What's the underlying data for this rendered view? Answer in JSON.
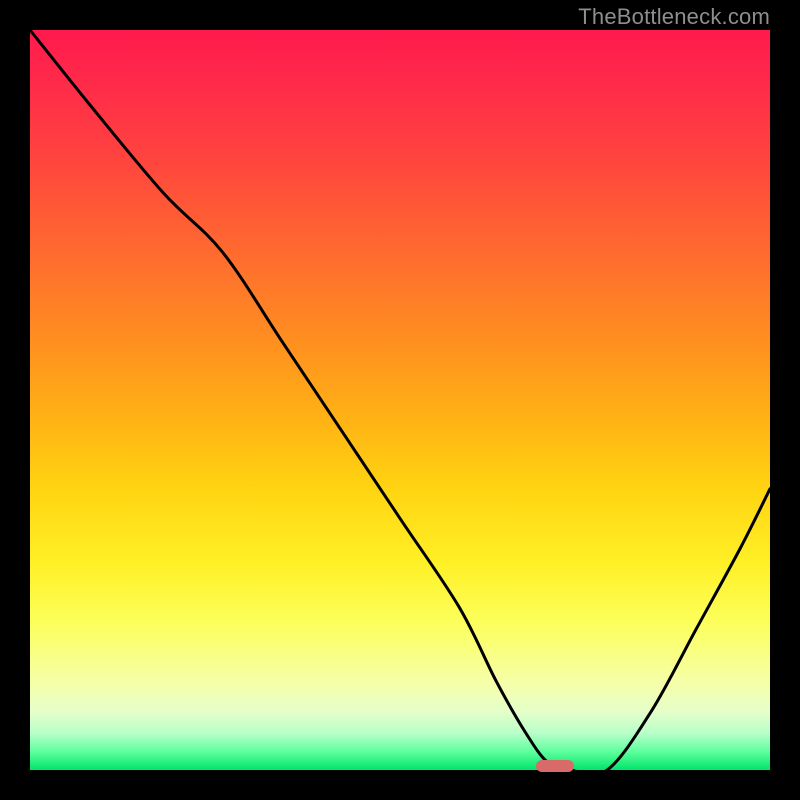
{
  "watermark": "TheBottleneck.com",
  "chart_data": {
    "type": "line",
    "title": "",
    "xlabel": "",
    "ylabel": "",
    "xlim": [
      0,
      100
    ],
    "ylim": [
      0,
      100
    ],
    "grid": false,
    "legend": false,
    "background_gradient": {
      "top": "#ff1a4d",
      "mid": "#ffd411",
      "bottom": "#00e56a"
    },
    "series": [
      {
        "name": "bottleneck-curve",
        "color": "#000000",
        "x": [
          0,
          8,
          18,
          26,
          34,
          42,
          50,
          58,
          63,
          67,
          70,
          73,
          78,
          84,
          90,
          96,
          100
        ],
        "y": [
          100,
          90,
          78,
          70,
          58,
          46,
          34,
          22,
          12,
          5,
          1,
          0,
          0,
          8,
          19,
          30,
          38
        ]
      }
    ],
    "marker": {
      "x": 71,
      "y": 0.5,
      "color": "#d86a6a",
      "shape": "pill"
    }
  }
}
